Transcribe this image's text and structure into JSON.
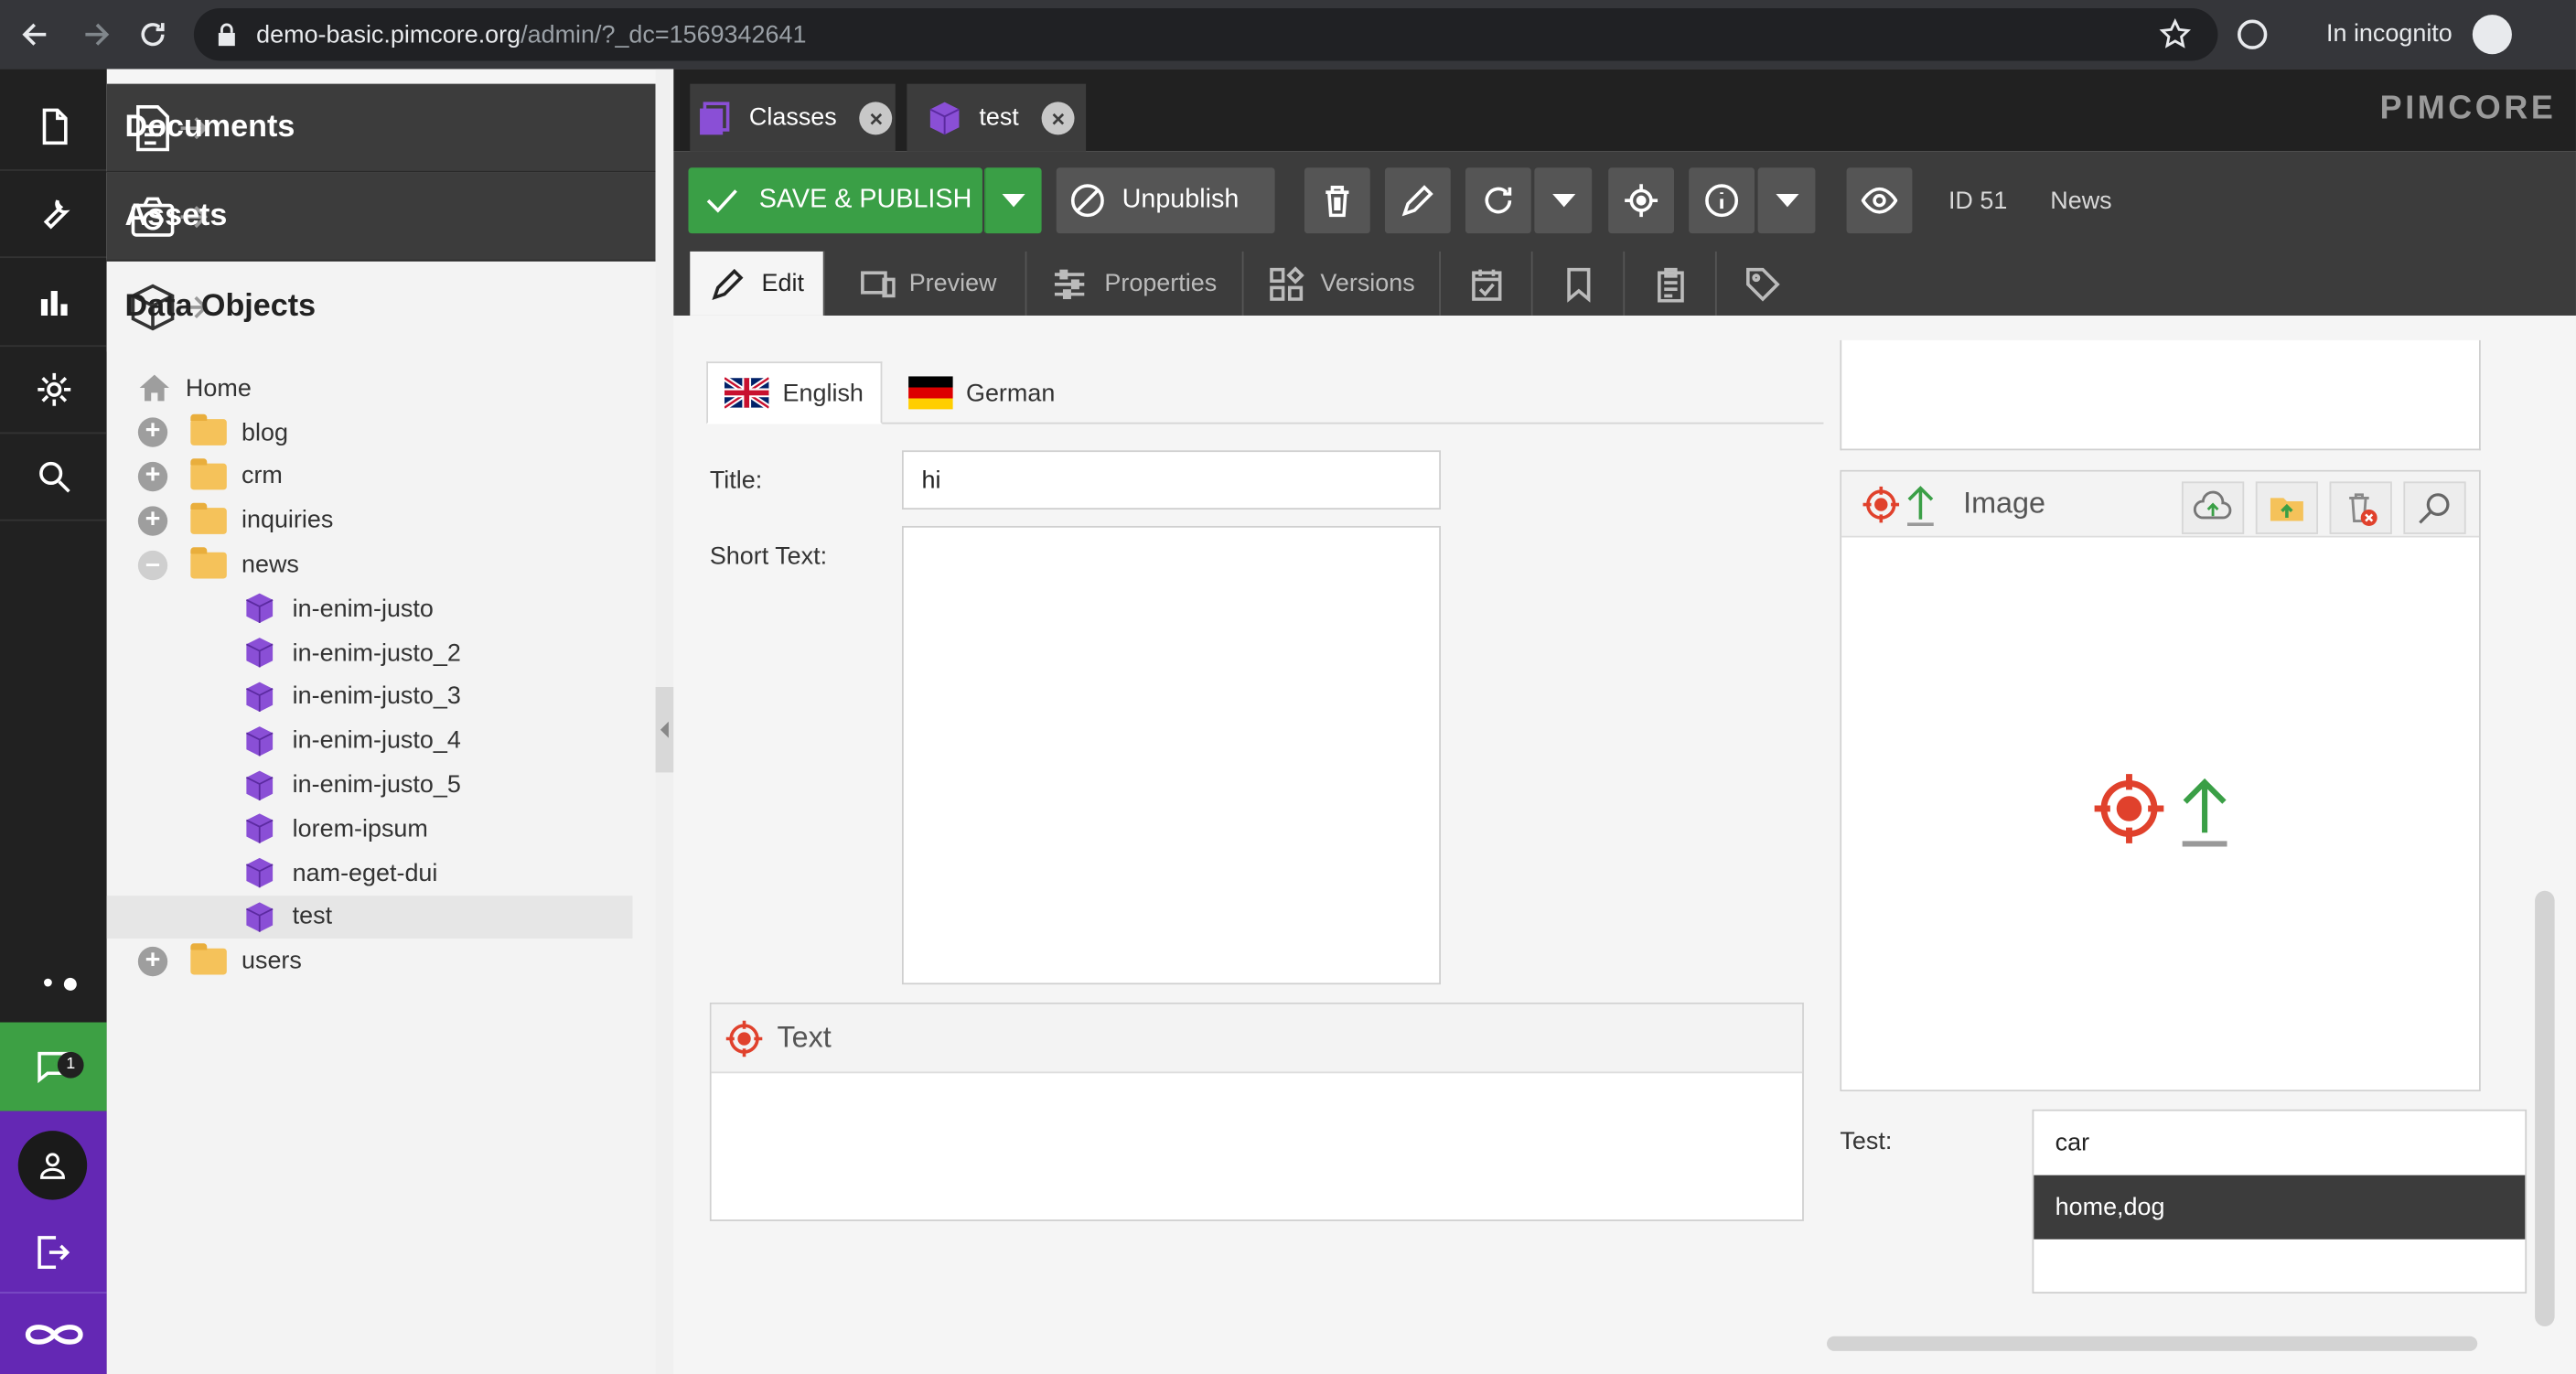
{
  "browser": {
    "url_host": "demo-basic.pimcore.org",
    "url_path": "/admin/?_dc=1569342641",
    "incognito_label": "In incognito"
  },
  "leftbar": {
    "items": [
      "file-icon",
      "wrench-icon",
      "bar-chart-icon",
      "gear-icon",
      "search-icon"
    ],
    "chat_badge": "1"
  },
  "tree_panel": {
    "accordions": [
      {
        "label": "Documents",
        "icon": "document-icon"
      },
      {
        "label": "Assets",
        "icon": "camera-icon"
      },
      {
        "label": "Data Objects",
        "icon": "cube-icon"
      }
    ],
    "nodes": [
      {
        "label": "Home",
        "kind": "home",
        "level": 0
      },
      {
        "label": "blog",
        "kind": "folder",
        "level": 0,
        "expander": "plus"
      },
      {
        "label": "crm",
        "kind": "folder",
        "level": 0,
        "expander": "plus"
      },
      {
        "label": "inquiries",
        "kind": "folder",
        "level": 0,
        "expander": "plus"
      },
      {
        "label": "news",
        "kind": "folder",
        "level": 0,
        "expander": "minus"
      },
      {
        "label": "in-enim-justo",
        "kind": "object",
        "level": 1
      },
      {
        "label": "in-enim-justo_2",
        "kind": "object",
        "level": 1
      },
      {
        "label": "in-enim-justo_3",
        "kind": "object",
        "level": 1
      },
      {
        "label": "in-enim-justo_4",
        "kind": "object",
        "level": 1
      },
      {
        "label": "in-enim-justo_5",
        "kind": "object",
        "level": 1
      },
      {
        "label": "lorem-ipsum",
        "kind": "object",
        "level": 1
      },
      {
        "label": "nam-eget-dui",
        "kind": "object",
        "level": 1
      },
      {
        "label": "test",
        "kind": "object",
        "level": 1,
        "selected": true
      },
      {
        "label": "users",
        "kind": "folder",
        "level": 0,
        "expander": "plus"
      }
    ]
  },
  "tabs": [
    {
      "label": "Classes",
      "icon": "classes-icon"
    },
    {
      "label": "test",
      "icon": "cube-icon"
    }
  ],
  "brand": "PIMCORE",
  "toolbar": {
    "save_publish": "SAVE & PUBLISH",
    "unpublish": "Unpublish",
    "id_label": "ID 51",
    "class_label": "News"
  },
  "subtabs": [
    {
      "label": "Edit",
      "icon": "pencil-icon"
    },
    {
      "label": "Preview",
      "icon": "devices-icon"
    },
    {
      "label": "Properties",
      "icon": "sliders-icon"
    },
    {
      "label": "Versions",
      "icon": "versions-icon"
    },
    {
      "label": "",
      "icon": "calendar-check-icon"
    },
    {
      "label": "",
      "icon": "bookmark-icon"
    },
    {
      "label": "",
      "icon": "clipboard-icon"
    },
    {
      "label": "",
      "icon": "tag-icon"
    }
  ],
  "form": {
    "lang_tabs": [
      "English",
      "German"
    ],
    "title_label": "Title:",
    "title_value": "hi",
    "short_text_label": "Short Text:",
    "short_text_value": "",
    "text_panel_title": "Text",
    "image_panel_title": "Image",
    "test_label": "Test:",
    "test_options": [
      "car",
      "home,dog",
      ""
    ]
  },
  "colors": {
    "accent_green": "#3a9f46",
    "pimcore_purple": "#6428b4",
    "target_red": "#e0412c"
  }
}
